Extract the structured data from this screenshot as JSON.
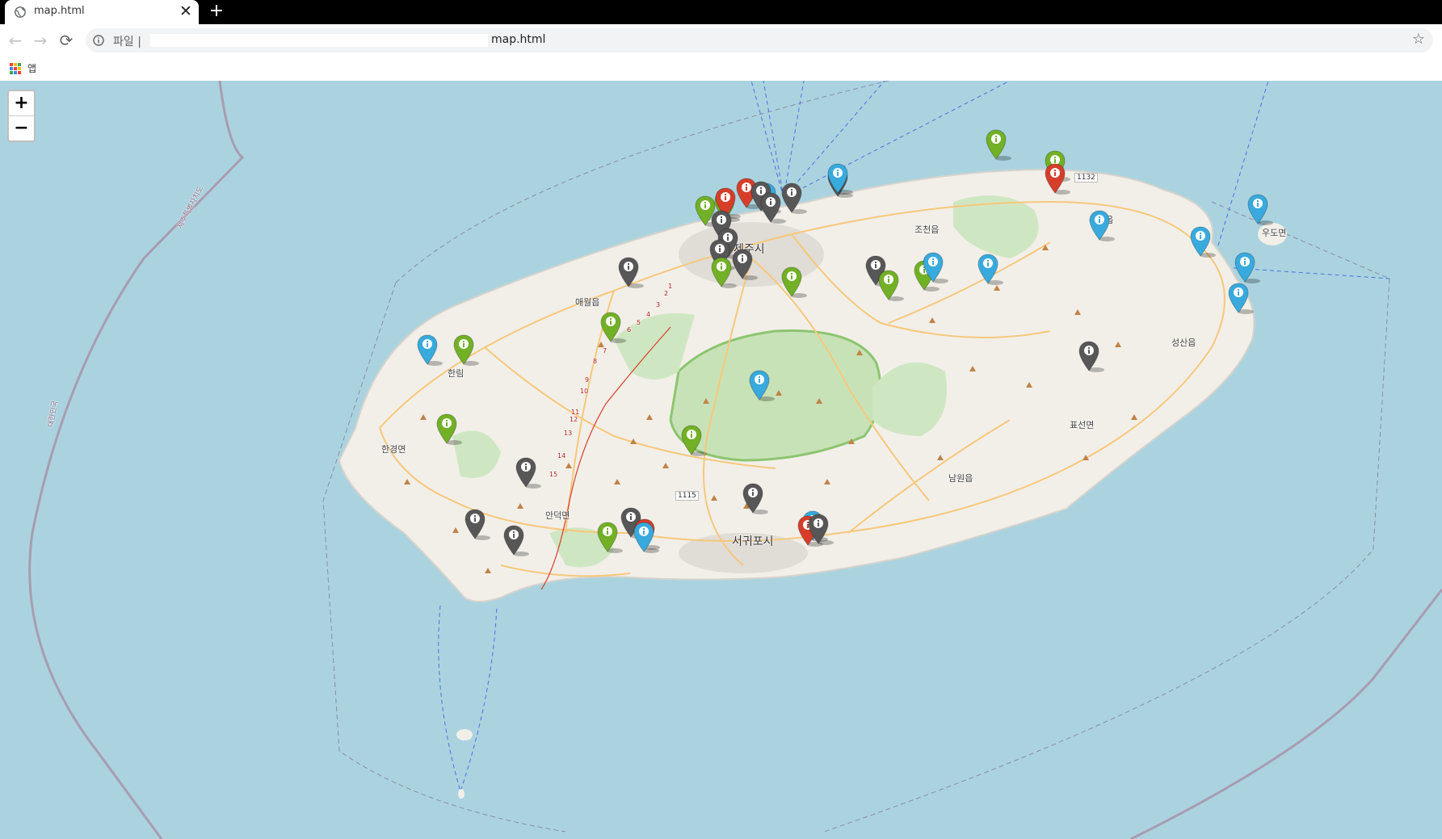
{
  "browser": {
    "tab_title": "map.html",
    "tab_close": "✕",
    "new_tab": "+",
    "back": "←",
    "forward": "→",
    "reload": "⟳",
    "protocol_label": "파일 |",
    "url": "map.html",
    "bookmark_star": "☆",
    "bookmarks_apps_label": "앱"
  },
  "map": {
    "zoom_in": "+",
    "zoom_out": "−",
    "labels": {
      "jeju_city": "제주시",
      "seogwipo_city": "서귀포시",
      "aewol": "애월읍",
      "hallim": "한림",
      "hangyeong": "한경면",
      "andeok": "안덕면",
      "jocheon": "조천읍",
      "gujwa": "구좌읍",
      "udo": "우도면",
      "seongsan": "성산읍",
      "pyoseon": "표선면",
      "namwon": "남원읍",
      "road_1132": "1132",
      "road_1115": "1115",
      "boundary_top": "제주특별자치도",
      "boundary_left": "대한민국"
    },
    "route_numbers": [
      "1",
      "2",
      "3",
      "4",
      "5",
      "6",
      "7",
      "8",
      "9",
      "10",
      "11",
      "12",
      "13",
      "14",
      "15"
    ],
    "marker_colors": {
      "gray": "#575757",
      "green": "#72b026",
      "blue": "#38aadd",
      "red": "#d63e2a"
    },
    "marker_icon": "info-sign-icon"
  }
}
